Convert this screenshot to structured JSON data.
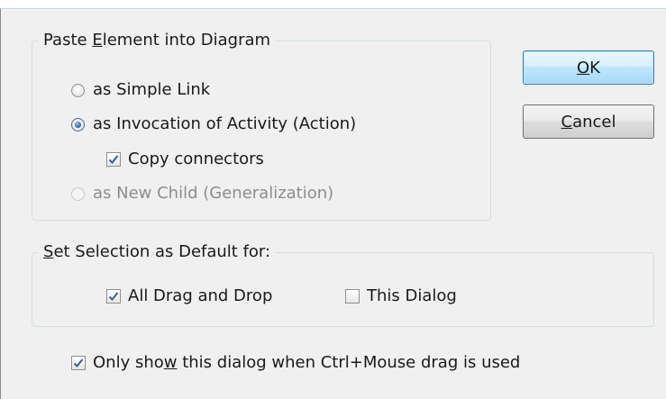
{
  "paste_group": {
    "legend_prefix": "Paste ",
    "legend_mnemonic": "E",
    "legend_suffix": "lement into Diagram",
    "options": {
      "simple_link": "as Simple Link",
      "invocation": "as Invocation of Activity (Action)",
      "copy_connectors": "Copy connectors",
      "new_child": "as New Child (Generalization)"
    }
  },
  "buttons": {
    "ok_mnemonic": "O",
    "ok_rest": "K",
    "cancel_mnemonic": "C",
    "cancel_rest": "ancel"
  },
  "default_group": {
    "legend_mnemonic": "S",
    "legend_rest": "et Selection as Default for:",
    "all_drag_drop": "All Drag and Drop",
    "this_dialog": "This Dialog"
  },
  "only_show": {
    "prefix": "Only sho",
    "mnemonic": "w",
    "suffix": " this dialog when Ctrl+Mouse drag is used"
  },
  "state": {
    "simple_link_selected": false,
    "invocation_selected": true,
    "new_child_selected": false,
    "new_child_enabled": false,
    "copy_connectors_checked": true,
    "all_drag_drop_checked": true,
    "this_dialog_checked": false,
    "only_show_checked": true
  }
}
